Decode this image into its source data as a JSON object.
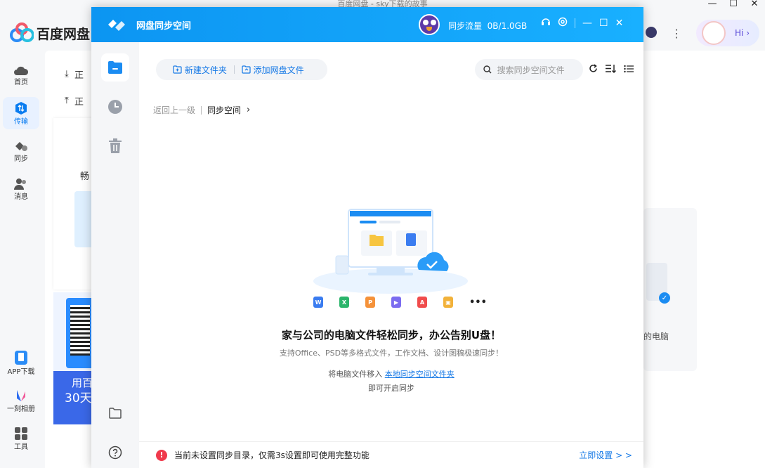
{
  "bg": {
    "title": "百度网盘 - sky下载的故事",
    "brand": "百度网盘",
    "nav": [
      {
        "label": "首页",
        "icon": "cloud-icon"
      },
      {
        "label": "传输",
        "icon": "transfer-icon"
      },
      {
        "label": "同步",
        "icon": "sync-icon"
      },
      {
        "label": "消息",
        "icon": "message-icon"
      }
    ],
    "nav_bottom": [
      {
        "label": "APP下载",
        "icon": "phone-icon"
      },
      {
        "label": "一刻相册",
        "icon": "album-icon"
      },
      {
        "label": "工具",
        "icon": "tools-icon"
      }
    ],
    "trans_1": "正",
    "trans_2": "正",
    "card_text": "畅",
    "qr_text_1": "用百",
    "qr_text_2": "30天",
    "right_card_text": "的电脑",
    "hi": "Hi"
  },
  "sync": {
    "title": "网盘同步空间",
    "flow_label": "同步流量",
    "flow_value": "0B/1.0GB",
    "new_folder": "新建文件夹",
    "add_file": "添加网盘文件",
    "search_placeholder": "搜索同步空间文件",
    "bc_back": "返回上一级",
    "bc_current": "同步空间",
    "headline": "家与公司的电脑文件轻松同步，办公告别U盘！",
    "sub": "支持Office、PSD等多格式文件，工作文档、设计图稿极速同步！",
    "hint_prefix": "将电脑文件移入",
    "hint_link": "本地同步空间文件夹",
    "hint2": "即可开启同步",
    "warn_text": "当前未设置同步目录，仅需3s设置即可使用完整功能",
    "footer_link": "立即设置 > >",
    "file_types": [
      {
        "name": "word",
        "color": "#3a7cf0",
        "glyph": "W"
      },
      {
        "name": "excel",
        "color": "#2bb56b",
        "glyph": "X"
      },
      {
        "name": "ppt",
        "color": "#f5923a",
        "glyph": "P"
      },
      {
        "name": "video",
        "color": "#7b6cf0",
        "glyph": "▶"
      },
      {
        "name": "pdf",
        "color": "#f04c4c",
        "glyph": "A"
      },
      {
        "name": "image",
        "color": "#f2b23a",
        "glyph": "▣"
      }
    ],
    "more": "•••"
  }
}
